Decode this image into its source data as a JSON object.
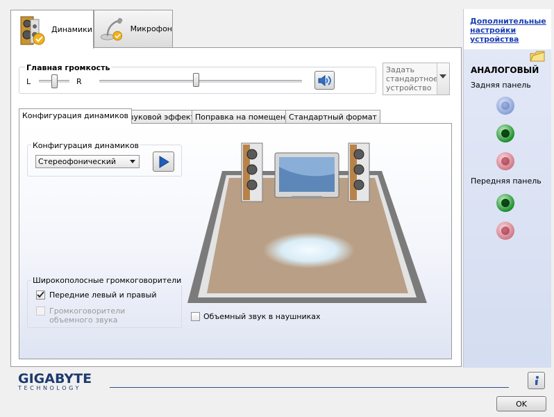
{
  "device_tabs": [
    {
      "label": "Динамики",
      "icon": "speaker-icon"
    },
    {
      "label": "Микрофон",
      "icon": "microphone-icon"
    }
  ],
  "volume": {
    "title": "Главная громкость",
    "left_label": "L",
    "right_label": "R",
    "balance": 0.5,
    "level": 0.5,
    "mute_icon": "speaker-volume-icon"
  },
  "default_device": {
    "label": "Задать стандартное устройство"
  },
  "inner_tabs": [
    "Конфигурация динамиков",
    "Звуковой эффект",
    "Поправка на помещение",
    "Стандартный формат"
  ],
  "speaker_config": {
    "group_title": "Конфигурация динамиков",
    "selected": "Стереофонический",
    "play_icon": "play-icon"
  },
  "wideband": {
    "title": "Широкополосные громкоговорители",
    "front_lr": {
      "label": "Передние левый и правый",
      "checked": true
    },
    "surround": {
      "label": "Громкоговорители объемного звука",
      "checked": false,
      "disabled": true
    }
  },
  "headphones": {
    "label": "Объемный звук в наушниках",
    "checked": false
  },
  "side": {
    "link": "Дополнительные настройки устройства",
    "analog_title": "АНАЛОГОВЫЙ",
    "rear_label": "Задняя панель",
    "front_label": "Передняя панель"
  },
  "footer": {
    "brand": "GIGABYTE",
    "brand_sub": "TECHNOLOGY",
    "ok_label": "OK",
    "info_icon": "info-icon"
  },
  "colors": {
    "jack_blue": "#7f97d0",
    "jack_green": "#1f8f2f",
    "jack_pink": "#d27b89",
    "brand": "#1e3a6e",
    "floor": "#b99f86"
  }
}
